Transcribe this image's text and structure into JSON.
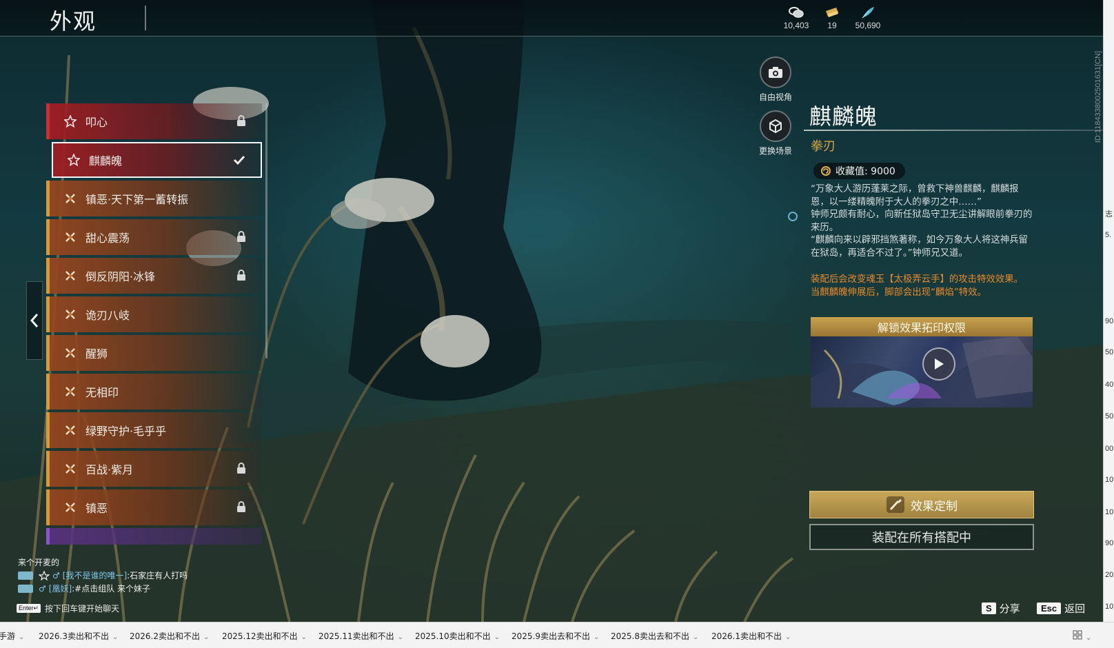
{
  "header": {
    "title": "外观",
    "currencies": [
      {
        "icon": "coin-stack-icon",
        "value": "10,403"
      },
      {
        "icon": "gold-ticket-icon",
        "value": "19"
      },
      {
        "icon": "feather-icon",
        "value": "50,690"
      }
    ]
  },
  "list": {
    "items": [
      {
        "label": "叩心",
        "icon": "star-icon",
        "locked": true,
        "selected": false,
        "style": "red"
      },
      {
        "label": "麒麟魄",
        "icon": "star-icon",
        "locked": false,
        "selected": true,
        "style": "red"
      },
      {
        "label": "镇恶·天下第一蓄转振",
        "icon": "cross-icon",
        "locked": false,
        "selected": false,
        "style": "orange"
      },
      {
        "label": "甜心震荡",
        "icon": "cross-icon",
        "locked": true,
        "selected": false,
        "style": "orange"
      },
      {
        "label": "倒反阴阳·冰锋",
        "icon": "cross-icon",
        "locked": true,
        "selected": false,
        "style": "orange"
      },
      {
        "label": "诡刃八岐",
        "icon": "cross-icon",
        "locked": false,
        "selected": false,
        "style": "orange"
      },
      {
        "label": "醒狮",
        "icon": "cross-icon",
        "locked": false,
        "selected": false,
        "style": "orange"
      },
      {
        "label": "无相印",
        "icon": "cross-icon",
        "locked": false,
        "selected": false,
        "style": "orange"
      },
      {
        "label": "绿野守护·毛乎乎",
        "icon": "cross-icon",
        "locked": false,
        "selected": false,
        "style": "orange"
      },
      {
        "label": "百战·紫月",
        "icon": "cross-icon",
        "locked": true,
        "selected": false,
        "style": "orange"
      },
      {
        "label": "镇恶",
        "icon": "cross-icon",
        "locked": true,
        "selected": false,
        "style": "orange"
      }
    ]
  },
  "side_buttons": {
    "free_view": "自由视角",
    "change_scene": "更换场景"
  },
  "detail": {
    "name": "麒麟魄",
    "type": "拳刃",
    "collect_value": "收藏值: 9000",
    "description": [
      "“万象大人游历蓬莱之际，曾救下神兽麒麟，麒麟报恩，以一缕精魄附于大人的拳刃之中……”",
      "钟师兄颇有耐心，向新任狱岛守卫无尘讲解眼前拳刃的来历。",
      "“麒麟向来以辟邪挡煞著称，如今万象大人将这神兵留在狱岛，再适合不过了。”钟师兄又道。"
    ],
    "effect": [
      "装配后会改变魂玉【太极弄云手】的攻击特效效果。",
      "当麒麟魄伸展后，脚部会出现“麟焰”特效。"
    ],
    "unlock_title": "解锁效果拓印权限",
    "custom_button": "效果定制",
    "equip_button": "装配在所有搭配中",
    "id_text": "ID:1184338002501631[CN]"
  },
  "chat": {
    "lines": [
      {
        "text": "来个开麦的"
      },
      {
        "symbols": "♂",
        "name": "[我不是谁的唯一]",
        "message": ":石家庄有人打吗"
      },
      {
        "symbols": "♂",
        "name": "[凰妖]",
        "message": ":#点击组队 来个妹子"
      }
    ],
    "hint_key": "Enter↵",
    "hint": "按下回车键开始聊天"
  },
  "hotkeys": [
    {
      "key": "S",
      "label": "分享"
    },
    {
      "key": "Esc",
      "label": "返回"
    }
  ],
  "taskbar": {
    "tabs": [
      "手游",
      "2026.3卖出和不出",
      "2026.2卖出和不出",
      "2025.12卖出和不出",
      "2025.11卖出和不出",
      "2025.10卖出和不出",
      "2025.9卖出去和不出",
      "2025.8卖出去和不出",
      "2026.1卖出和不出"
    ]
  },
  "colors": {
    "accent_gold": "#d9a544",
    "effect_orange": "#e7892a",
    "item_red": "#c9302c",
    "item_orange": "#d39a3a"
  }
}
